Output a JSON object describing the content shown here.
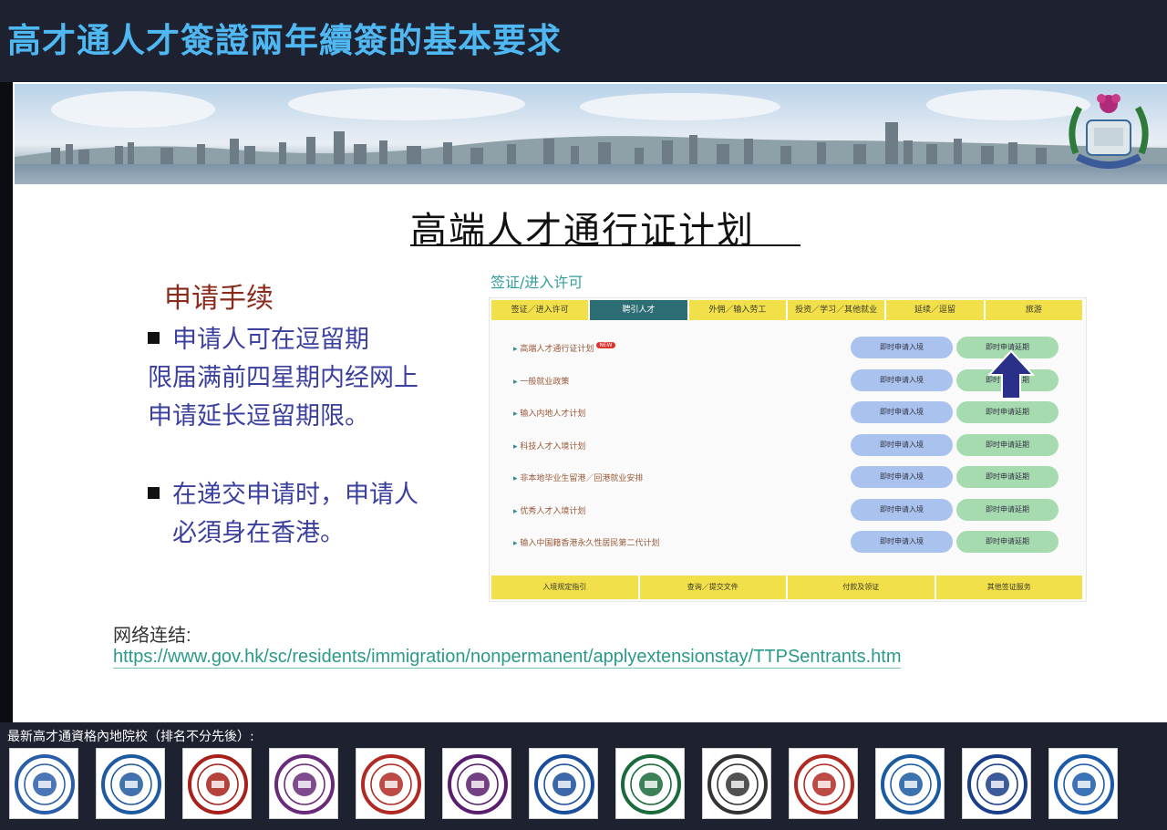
{
  "header": {
    "title": "高才通人才簽證兩年續簽的基本要求"
  },
  "slide": {
    "title": "高端人才通行证计划",
    "procedure_heading": "申请手续",
    "bullets": [
      {
        "lines": [
          "申请人可在逗留期",
          "限届满前四星期内经网上",
          "申请延长逗留期限。"
        ]
      },
      {
        "lines": [
          "在递交申请时，申请人",
          "必須身在香港。"
        ]
      }
    ],
    "link_label": "网络连结:",
    "link_url": "https://www.gov.hk/sc/residents/immigration/nonpermanent/applyextensionstay/TTPSentrants.htm"
  },
  "embedded_screenshot": {
    "section_label": "签证/进入许可",
    "nav_tabs": [
      "签证／进入许可",
      "聘引人才",
      "外佣／输入劳工",
      "投资／学习／其他就业",
      "延续／逗留",
      "旅游"
    ],
    "active_tab_index": 1,
    "new_badge": "NEW",
    "rows": [
      {
        "label": "高端人才通行证计划",
        "is_new": true
      },
      {
        "label": "一般就业政策",
        "is_new": false
      },
      {
        "label": "输入内地人才计划",
        "is_new": false
      },
      {
        "label": "科技人才入境计划",
        "is_new": false
      },
      {
        "label": "非本地毕业生留港／回港就业安排",
        "is_new": false
      },
      {
        "label": "优秀人才入境计划",
        "is_new": false
      },
      {
        "label": "输入中国籍香港永久性居民第二代计划",
        "is_new": false
      }
    ],
    "button_entry_label": "即时申请入境",
    "button_extension_label": "即时申请延期",
    "footer_links": [
      "入境规定指引",
      "查询／提交文件",
      "付款及领证",
      "其他签证服务"
    ]
  },
  "bottom": {
    "caption": "最新高才通資格內地院校（排名不分先後）:",
    "logos": [
      {
        "icon": "ustc-logo-icon",
        "color": "#2a5ea8"
      },
      {
        "icon": "ucas-logo-icon",
        "color": "#1f5aa0"
      },
      {
        "icon": "pku-logo-icon",
        "color": "#a8201a"
      },
      {
        "icon": "nju-logo-icon",
        "color": "#6a2a7a"
      },
      {
        "icon": "sjtu-logo-icon",
        "color": "#b02a24"
      },
      {
        "icon": "nanjing-logo-icon",
        "color": "#5a1e6e"
      },
      {
        "icon": "zju-logo-icon",
        "color": "#1a4e9a"
      },
      {
        "icon": "sysu-logo-icon",
        "color": "#1a6a3a"
      },
      {
        "icon": "whu-logo-icon",
        "color": "#333333"
      },
      {
        "icon": "xjtu-logo-icon",
        "color": "#b02a24"
      },
      {
        "icon": "hit-logo-icon",
        "color": "#1a5aa0"
      },
      {
        "icon": "fudan-logo-icon",
        "color": "#1a3e8a"
      },
      {
        "icon": "csu-logo-icon",
        "color": "#1a5aa8"
      }
    ]
  }
}
